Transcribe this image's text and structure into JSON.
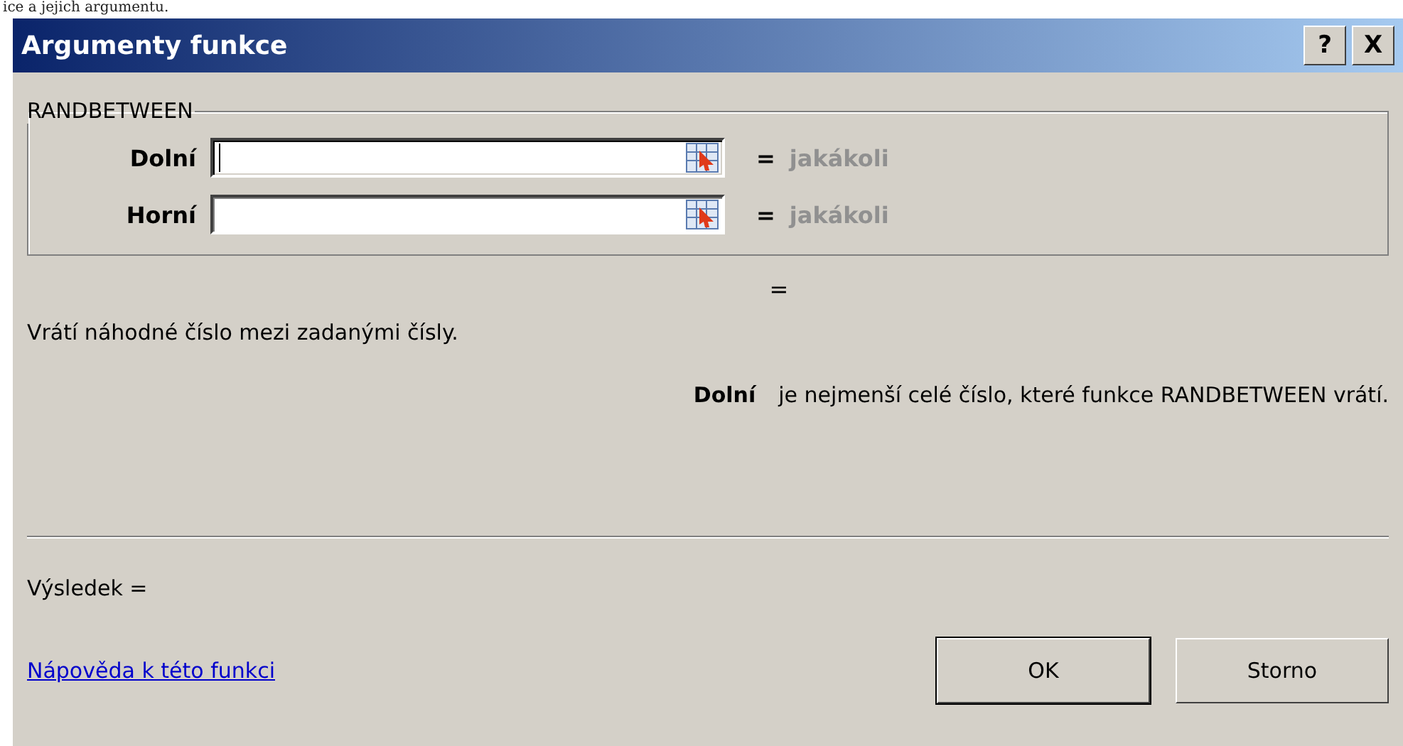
{
  "page_text": "ice a jejich argumentu.",
  "window": {
    "title": "Argumenty funkce",
    "title_buttons": [
      "?",
      "X"
    ]
  },
  "group": {
    "label": "RANDBETWEEN",
    "arguments": [
      {
        "label": "Dolní",
        "focused": true,
        "equals": "=",
        "result": "jakákoli"
      },
      {
        "label": "Horní",
        "focused": false,
        "equals": "=",
        "result": "jakákoli"
      }
    ]
  },
  "formula_result": "=",
  "description": "Vrátí náhodné číslo mezi zadanými čísly.",
  "argument_help": {
    "name": "Dolní",
    "text": "je nejmenší celé číslo, které funkce RANDBETWEEN vrátí."
  },
  "result_label": "Výsledek =",
  "help_link": "Nápověda k této funkci",
  "buttons": [
    "OK",
    "Storno"
  ]
}
